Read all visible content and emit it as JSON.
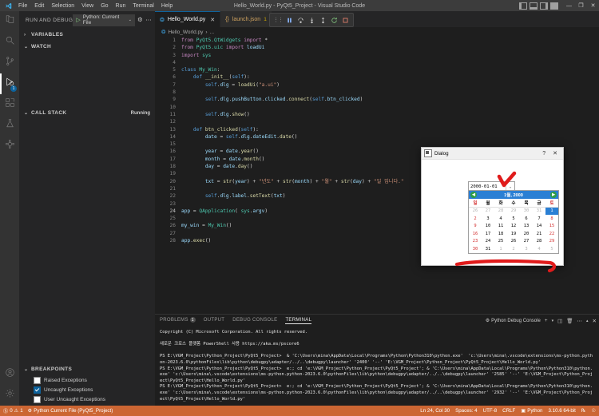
{
  "titlebar": {
    "title": "Hello_World.py - PyQt5_Project - Visual Studio Code",
    "menus": [
      "File",
      "Edit",
      "Selection",
      "View",
      "Go",
      "Run",
      "Terminal",
      "Help"
    ],
    "window_buttons": [
      "—",
      "❐",
      "✕"
    ]
  },
  "activitybar": {
    "items": [
      {
        "name": "explorer",
        "icon": "files-icon"
      },
      {
        "name": "search",
        "icon": "search-icon"
      },
      {
        "name": "source-control",
        "icon": "source-control-icon"
      },
      {
        "name": "run-and-debug",
        "icon": "run-debug-icon",
        "badge": "1",
        "active": true
      },
      {
        "name": "extensions",
        "icon": "extensions-icon"
      },
      {
        "name": "testing",
        "icon": "beaker-icon"
      },
      {
        "name": "docker",
        "icon": "docker-icon"
      }
    ],
    "bottom": [
      {
        "name": "accounts",
        "icon": "account-icon"
      },
      {
        "name": "manage",
        "icon": "gear-icon"
      }
    ]
  },
  "sidebar": {
    "header": "RUN AND DEBUG",
    "config_label": "Python: Current File",
    "config_chevron": "⌄",
    "gear_icon": "gear-icon",
    "more_icon": "ellipsis-icon",
    "sections": [
      {
        "label": "VARIABLES",
        "twisty": "›",
        "badge": ""
      },
      {
        "label": "WATCH",
        "twisty": "⌄",
        "badge": ""
      },
      {
        "label": "CALL STACK",
        "twisty": "⌄",
        "badge": "Running"
      },
      {
        "label": "BREAKPOINTS",
        "twisty": "⌄",
        "badge": ""
      }
    ],
    "breakpoints": [
      {
        "label": "Raised Exceptions",
        "checked": false
      },
      {
        "label": "Uncaught Exceptions",
        "checked": true
      },
      {
        "label": "User Uncaught Exceptions",
        "checked": false
      }
    ]
  },
  "editor": {
    "tabs": [
      {
        "label": "Hello_World.py",
        "icon": "python-file-icon",
        "active": true,
        "close": "✕"
      },
      {
        "label": "launch.json",
        "icon": "json-file-icon",
        "active": false,
        "warning_count": "1"
      }
    ],
    "breadcrumb": [
      "Hello_World.py",
      "›",
      "..."
    ],
    "debug_toolbar": [
      {
        "name": "drag-handle",
        "icon": "grip-icon"
      },
      {
        "name": "pause-button",
        "icon": "pause-icon"
      },
      {
        "name": "step-over-button",
        "icon": "step-over-icon"
      },
      {
        "name": "step-into-button",
        "icon": "step-into-icon"
      },
      {
        "name": "step-out-button",
        "icon": "step-out-icon"
      },
      {
        "name": "restart-button",
        "icon": "restart-icon"
      },
      {
        "name": "stop-button",
        "icon": "stop-icon"
      }
    ],
    "code_lines": [
      {
        "n": "1",
        "html": "<span class=\"k2\">from</span> <span class=\"cls\">PyQt5.QtWidgets</span> <span class=\"k2\">import</span> <span class=\"op\">*</span>"
      },
      {
        "n": "2",
        "html": "<span class=\"k2\">from</span> <span class=\"cls\">PyQt5.uic</span> <span class=\"k2\">import</span> <span class=\"var\">loadUi</span>"
      },
      {
        "n": "3",
        "html": "<span class=\"k2\">import</span> <span class=\"cls\">sys</span>"
      },
      {
        "n": "4",
        "html": ""
      },
      {
        "n": "5",
        "html": "<span class=\"k\">class</span> <span class=\"cls\">My_Win</span><span class=\"plain\">:</span>"
      },
      {
        "n": "6",
        "html": "    <span class=\"k\">def</span> <span class=\"fn\">__init__</span><span class=\"plain\">(</span><span class=\"k\">self</span><span class=\"plain\">):</span>"
      },
      {
        "n": "7",
        "html": "        <span class=\"k\">self</span><span class=\"plain\">.</span><span class=\"var\">dlg</span> <span class=\"op\">=</span> <span class=\"fn\">loadUi</span><span class=\"plain\">(</span><span class=\"str\">\"a.ui\"</span><span class=\"plain\">)</span>"
      },
      {
        "n": "8",
        "html": ""
      },
      {
        "n": "9",
        "html": "        <span class=\"k\">self</span><span class=\"plain\">.</span><span class=\"var\">dlg</span><span class=\"plain\">.</span><span class=\"var\">pushButton</span><span class=\"plain\">.</span><span class=\"var\">clicked</span><span class=\"plain\">.</span><span class=\"fn\">connect</span><span class=\"plain\">(</span><span class=\"k\">self</span><span class=\"plain\">.</span><span class=\"var\">btn_clicked</span><span class=\"plain\">)</span>"
      },
      {
        "n": "10",
        "html": ""
      },
      {
        "n": "11",
        "html": "        <span class=\"k\">self</span><span class=\"plain\">.</span><span class=\"var\">dlg</span><span class=\"plain\">.</span><span class=\"fn\">show</span><span class=\"plain\">()</span>"
      },
      {
        "n": "12",
        "html": ""
      },
      {
        "n": "13",
        "html": "    <span class=\"k\">def</span> <span class=\"fn\">btn_clicked</span><span class=\"plain\">(</span><span class=\"k\">self</span><span class=\"plain\">):</span>"
      },
      {
        "n": "14",
        "html": "        <span class=\"var\">date</span> <span class=\"op\">=</span> <span class=\"k\">self</span><span class=\"plain\">.</span><span class=\"var\">dlg</span><span class=\"plain\">.</span><span class=\"var\">dateEdit</span><span class=\"plain\">.</span><span class=\"fn\">date</span><span class=\"plain\">()</span>"
      },
      {
        "n": "15",
        "html": ""
      },
      {
        "n": "16",
        "html": "        <span class=\"var\">year</span> <span class=\"op\">=</span> <span class=\"var\">date</span><span class=\"plain\">.</span><span class=\"fn\">year</span><span class=\"plain\">()</span>"
      },
      {
        "n": "17",
        "html": "        <span class=\"var\">month</span> <span class=\"op\">=</span> <span class=\"var\">date</span><span class=\"plain\">.</span><span class=\"fn\">month</span><span class=\"plain\">()</span>"
      },
      {
        "n": "18",
        "html": "        <span class=\"var\">day</span> <span class=\"op\">=</span> <span class=\"var\">date</span><span class=\"plain\">.</span><span class=\"fn\">day</span><span class=\"plain\">()</span>"
      },
      {
        "n": "19",
        "html": ""
      },
      {
        "n": "20",
        "html": "        <span class=\"var\">txt</span> <span class=\"op\">=</span> <span class=\"fn\">str</span><span class=\"plain\">(</span><span class=\"var\">year</span><span class=\"plain\">)</span> <span class=\"op\">+</span> <span class=\"str\">\"년도\"</span> <span class=\"op\">+</span> <span class=\"fn\">str</span><span class=\"plain\">(</span><span class=\"var\">month</span><span class=\"plain\">)</span> <span class=\"op\">+</span> <span class=\"str\">\"월\"</span> <span class=\"op\">+</span> <span class=\"fn\">str</span><span class=\"plain\">(</span><span class=\"var\">day</span><span class=\"plain\">)</span> <span class=\"op\">+</span> <span class=\"str\">\"일 입니다.\"</span>"
      },
      {
        "n": "21",
        "html": ""
      },
      {
        "n": "22",
        "html": "        <span class=\"k\">self</span><span class=\"plain\">.</span><span class=\"var\">dlg</span><span class=\"plain\">.</span><span class=\"var\">label</span><span class=\"plain\">.</span><span class=\"fn\">setText</span><span class=\"plain\">(</span><span class=\"var\">txt</span><span class=\"plain\">)</span>"
      },
      {
        "n": "23",
        "html": ""
      },
      {
        "n": "24",
        "html": "<span class=\"var\">app</span> <span class=\"op\">=</span> <span class=\"cls\">QApplication</span><span class=\"plain\">(</span> <span class=\"cls\">sys</span><span class=\"plain\">.</span><span class=\"var\">argv</span><span class=\"plain\">)</span>"
      },
      {
        "n": "25",
        "html": ""
      },
      {
        "n": "26",
        "html": "<span class=\"var\">my_win</span> <span class=\"op\">=</span> <span class=\"cls\">My_Win</span><span class=\"plain\">()</span>"
      },
      {
        "n": "27",
        "html": ""
      },
      {
        "n": "28",
        "html": "<span class=\"var\">app</span><span class=\"plain\">.</span><span class=\"fn\">exec</span><span class=\"plain\">()</span>"
      }
    ]
  },
  "panel": {
    "tabs": [
      {
        "label": "PROBLEMS",
        "badge": "1",
        "active": false
      },
      {
        "label": "OUTPUT",
        "badge": "",
        "active": false
      },
      {
        "label": "DEBUG CONSOLE",
        "badge": "",
        "active": false
      },
      {
        "label": "TERMINAL",
        "badge": "",
        "active": true
      }
    ],
    "terminal_selector": "Python Debug Console",
    "right_icons": [
      "new-terminal-icon",
      "chevron-down-icon",
      "split-terminal-icon",
      "kill-terminal-icon",
      "ellipsis-icon",
      "chevron-up-icon",
      "close-panel-icon"
    ],
    "terminal_lines": [
      {
        "cls": "t-white",
        "text": "Copyright (C) Microsoft Corporation. All rights reserved."
      },
      {
        "cls": "t-white",
        "text": ""
      },
      {
        "cls": "t-white",
        "text": "새로운 크로스 플랫폼 PowerShell 사용 https://aka.ms/pscore6"
      },
      {
        "cls": "t-white",
        "text": ""
      },
      {
        "cls": "t-white",
        "text": "PS E:\\VGM_Project\\Python_Project\\PyQt5_Project>  & 'C:\\Users\\mina\\AppData\\Local\\Programs\\Python\\Python310\\python.exe'  'c:\\Users\\mina\\.vscode\\extensions\\ms-python.python-2023.6.0\\pythonFiles\\lib\\python\\debugpy\\adapter/../..\\debugpy\\launcher' '2400' '--' 'E:\\VGM_Project\\Python_Project\\PyQt5_Project\\Hello_World.py'"
      },
      {
        "cls": "t-white",
        "text": "PS E:\\VGM_Project\\Python_Project\\PyQt5_Project>  e:; cd 'e:\\VGM_Project\\Python_Project\\PyQt5_Project'; & 'C:\\Users\\mina\\AppData\\Local\\Programs\\Python\\Python310\\python.exe' 'c:\\Users\\mina\\.vscode\\extensions\\ms-python.python-2023.6.0\\pythonFiles\\lib\\python\\debugpy\\adapter/../..\\debugpy\\launcher' '2585' '--' 'E:\\VGM_Project\\Python_Project\\PyQt5_Project\\Hello_World.py'"
      },
      {
        "cls": "t-white",
        "text": "PS E:\\VGM_Project\\Python_Project\\PyQt5_Project>  e:; cd 'e:\\VGM_Project\\Python_Project\\PyQt5_Project'; & 'C:\\Users\\mina\\AppData\\Local\\Programs\\Python\\Python310\\python.exe' 'c:\\Users\\mina\\.vscode\\extensions\\ms-python.python-2023.6.0\\pythonFiles\\lib\\python\\debugpy\\adapter/../..\\debugpy\\launcher' '2932' '--' 'E:\\VGM_Project\\Python_Project\\PyQt5_Project\\Hello_World.py'"
      }
    ]
  },
  "statusbar": {
    "errors": "0",
    "warnings": "1",
    "debug_target": "Python Current File (PyQt5_Project)",
    "cursor": "Ln 24, Col 30",
    "indentation": "Spaces: 4",
    "encoding": "UTF-8",
    "eol": "CRLF",
    "language": "Python",
    "interpreter": "3.10.6 64-bit",
    "bell_icon": "bell-icon",
    "feedback_icon": "feedback-icon",
    "accent": "#cc6633"
  },
  "dialog": {
    "title": "Dialog",
    "help_button": "?",
    "close_button": "✕",
    "date_value": "2000-01-01",
    "date_chevron": "⌄",
    "calendar": {
      "prev_arrow": "◀",
      "next_arrow": "▶",
      "header": "1월, 2000",
      "weekdays": [
        "일",
        "월",
        "화",
        "수",
        "목",
        "금",
        "토"
      ],
      "weeks": [
        [
          {
            "d": "26",
            "dim": true
          },
          {
            "d": "27",
            "dim": true
          },
          {
            "d": "28",
            "dim": true
          },
          {
            "d": "29",
            "dim": true
          },
          {
            "d": "30",
            "dim": true
          },
          {
            "d": "31",
            "dim": true
          },
          {
            "d": "1",
            "sel": true
          }
        ],
        [
          {
            "d": "2",
            "sun": true
          },
          {
            "d": "3"
          },
          {
            "d": "4"
          },
          {
            "d": "5"
          },
          {
            "d": "6"
          },
          {
            "d": "7"
          },
          {
            "d": "8",
            "sat": true
          }
        ],
        [
          {
            "d": "9",
            "sun": true
          },
          {
            "d": "10"
          },
          {
            "d": "11"
          },
          {
            "d": "12"
          },
          {
            "d": "13"
          },
          {
            "d": "14"
          },
          {
            "d": "15",
            "sat": true
          }
        ],
        [
          {
            "d": "16",
            "sun": true
          },
          {
            "d": "17"
          },
          {
            "d": "18"
          },
          {
            "d": "19"
          },
          {
            "d": "20"
          },
          {
            "d": "21"
          },
          {
            "d": "22",
            "sat": true
          }
        ],
        [
          {
            "d": "23",
            "sun": true
          },
          {
            "d": "24"
          },
          {
            "d": "25"
          },
          {
            "d": "26"
          },
          {
            "d": "27"
          },
          {
            "d": "28"
          },
          {
            "d": "29",
            "sat": true
          }
        ],
        [
          {
            "d": "30",
            "sun": true
          },
          {
            "d": "31"
          },
          {
            "d": "1",
            "dim": true
          },
          {
            "d": "2",
            "dim": true
          },
          {
            "d": "3",
            "dim": true
          },
          {
            "d": "4",
            "dim": true
          },
          {
            "d": "5",
            "dim": true,
            "sat": true
          }
        ]
      ]
    },
    "annotation_color": "#e01b1b"
  }
}
